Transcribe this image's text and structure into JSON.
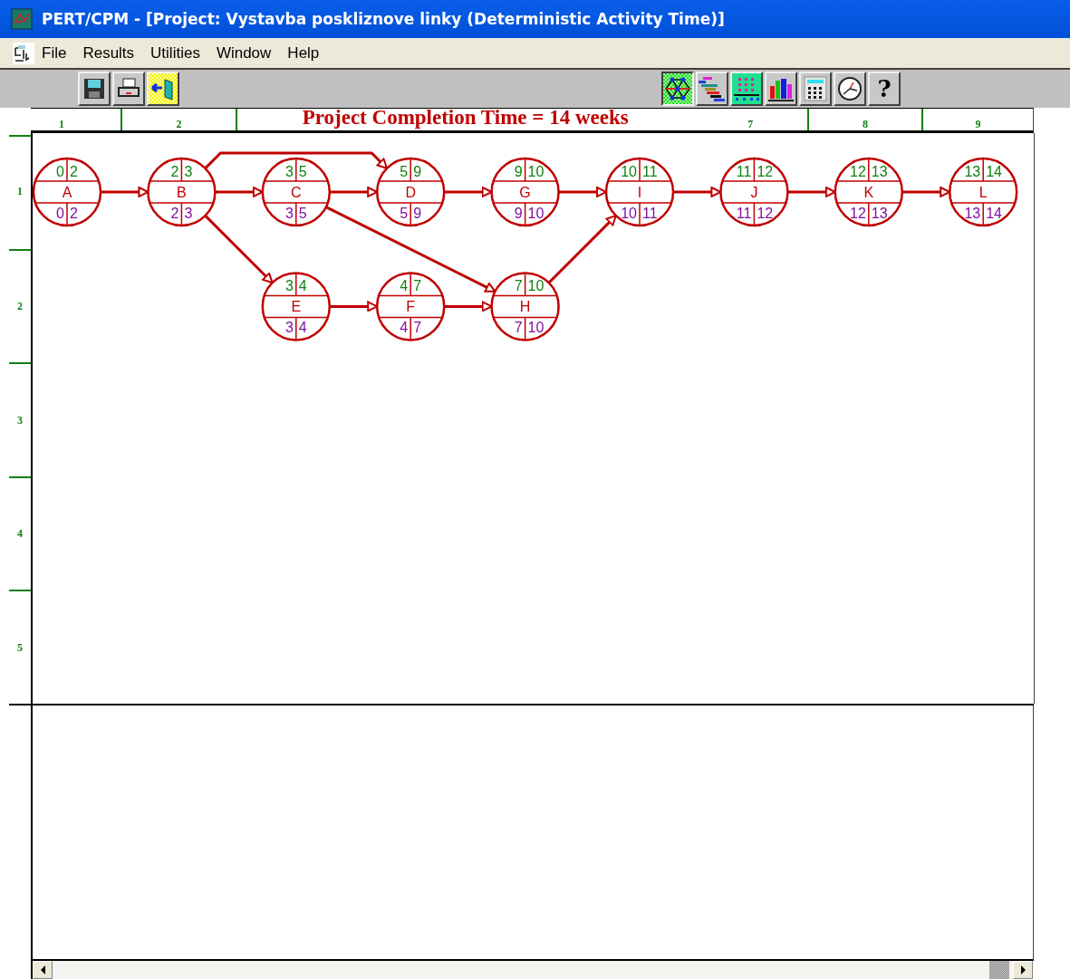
{
  "window": {
    "title": "PERT/CPM - [Project: Vystavba poskliznove linky (Deterministic Activity Time)]"
  },
  "menu": [
    "File",
    "Results",
    "Utilities",
    "Window",
    "Help"
  ],
  "toolbar": {
    "left": [
      {
        "kind": "save"
      },
      {
        "kind": "print"
      },
      {
        "kind": "exit"
      }
    ],
    "right": [
      {
        "kind": "network",
        "selected": true
      },
      {
        "kind": "gantt",
        "selected": false
      },
      {
        "kind": "grid",
        "selected": false
      },
      {
        "kind": "bars",
        "selected": false
      },
      {
        "kind": "calculator",
        "selected": false
      },
      {
        "kind": "clock",
        "selected": false
      },
      {
        "kind": "help",
        "label": "?",
        "selected": false
      }
    ]
  },
  "header": {
    "title": "Project Completion Time = 14 weeks",
    "columns": [
      "1",
      "2",
      "7",
      "8",
      "9"
    ]
  },
  "rows": [
    "1",
    "2",
    "3",
    "4",
    "5"
  ],
  "nodes": [
    {
      "name": "A",
      "es": "0",
      "ef": "2",
      "ls": "0",
      "lf": "2"
    },
    {
      "name": "B",
      "es": "2",
      "ef": "3",
      "ls": "2",
      "lf": "3"
    },
    {
      "name": "C",
      "es": "3",
      "ef": "5",
      "ls": "3",
      "lf": "5"
    },
    {
      "name": "D",
      "es": "5",
      "ef": "9",
      "ls": "5",
      "lf": "9"
    },
    {
      "name": "G",
      "es": "9",
      "ef": "10",
      "ls": "9",
      "lf": "10"
    },
    {
      "name": "I",
      "es": "10",
      "ef": "11",
      "ls": "10",
      "lf": "11"
    },
    {
      "name": "J",
      "es": "11",
      "ef": "12",
      "ls": "11",
      "lf": "12"
    },
    {
      "name": "K",
      "es": "12",
      "ef": "13",
      "ls": "12",
      "lf": "13"
    },
    {
      "name": "L",
      "es": "13",
      "ef": "14",
      "ls": "13",
      "lf": "14"
    },
    {
      "name": "E",
      "es": "3",
      "ef": "4",
      "ls": "3",
      "lf": "4"
    },
    {
      "name": "F",
      "es": "4",
      "ef": "7",
      "ls": "4",
      "lf": "7"
    },
    {
      "name": "H",
      "es": "7",
      "ef": "10",
      "ls": "7",
      "lf": "10"
    }
  ]
}
